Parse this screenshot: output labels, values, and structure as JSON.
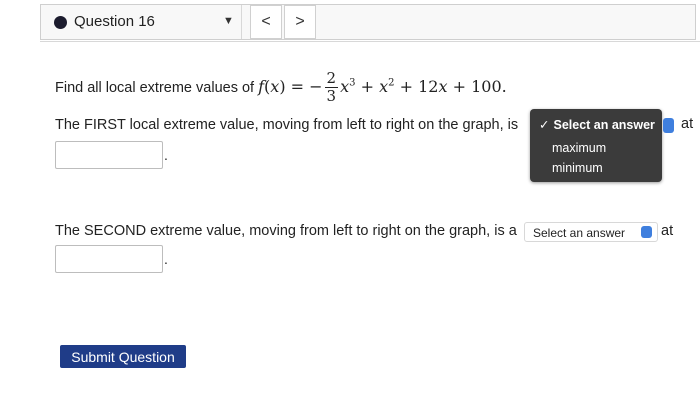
{
  "header": {
    "question_label": "Question 16",
    "prev": "<",
    "next": ">"
  },
  "problem": {
    "prompt": "Find all local extreme values of",
    "fn": "f",
    "var": "x",
    "eq": "=",
    "neg": "−",
    "frac_num": "2",
    "frac_den": "3",
    "e3": "3",
    "plus1": "+",
    "e2": "2",
    "plus2": "+",
    "lin": "12",
    "plus3": "+",
    "const": "100."
  },
  "first": {
    "sentence": "The FIRST local extreme value, moving from left to right on the graph, is",
    "at": "at",
    "period": ".",
    "answer_value": "",
    "dropdown": {
      "selected": "Select an answer",
      "check": "✓",
      "options": [
        "maximum",
        "minimum"
      ]
    }
  },
  "second": {
    "sentence": "The SECOND extreme value, moving from left to right on the graph, is a",
    "select_label": "Select an answer",
    "at": "at",
    "period": ".",
    "answer_value": ""
  },
  "submit_label": "Submit Question",
  "colors": {
    "dropdown_bg": "#3b3b3b",
    "accent_blue": "#3f7fde",
    "submit_bg": "#1f3c88"
  },
  "icons": {
    "question_status": "filled-circle",
    "question_caret": "triangle-down-icon",
    "select_arrows": "up-down-arrows-icon"
  }
}
